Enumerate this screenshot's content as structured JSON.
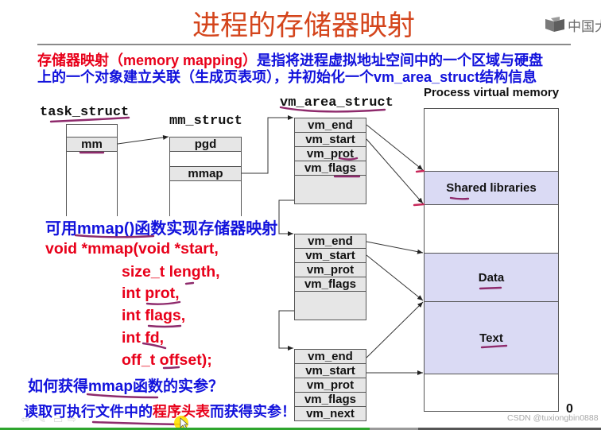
{
  "slide": {
    "title": "进程的存储器映射",
    "logo": {
      "icon": "book-logo-icon",
      "text": "中国大"
    },
    "intro": {
      "line1_red": "存储器映射（memory mapping）",
      "line1_blue": "是指将进程虚拟地址空间中的一个区域与硬盘",
      "line2": "上的一个对象建立关联（生成页表项），并初始化一个vm_area_struct结构信息"
    },
    "diagram": {
      "task_struct": {
        "label": "task_struct",
        "fields": [
          "mm"
        ]
      },
      "mm_struct": {
        "label": "mm_struct",
        "fields": [
          "pgd",
          "mmap"
        ]
      },
      "vm_area_struct": {
        "label": "vm_area_struct",
        "nodes": [
          {
            "fields": [
              "vm_end",
              "vm_start",
              "vm_prot",
              "vm_flags"
            ]
          },
          {
            "fields": [
              "vm_end",
              "vm_start",
              "vm_prot",
              "vm_flags"
            ]
          },
          {
            "fields": [
              "vm_end",
              "vm_start",
              "vm_prot",
              "vm_flags",
              "vm_next"
            ]
          }
        ]
      },
      "process_memory": {
        "label": "Process virtual memory",
        "regions": [
          "Shared libraries",
          "Data",
          "Text"
        ],
        "bottom_address": "0"
      }
    },
    "mmap_section": {
      "heading": "可用mmap()函数实现存储器映射",
      "signature": [
        "void *mmap(void *start,",
        "size_t length,",
        "int prot,",
        "int flags,",
        "int fd,",
        "off_t offset);"
      ],
      "question": "如何获得mmap函数的实参？",
      "answer": {
        "before": "读取可执行文件中的",
        "highlight": "程序头表",
        "after": "而获得实参！"
      }
    }
  },
  "watermark": "CSDN @tuxiongbin0888",
  "player": {
    "nav_icons": [
      "previous-arrow-icon",
      "pen-icon",
      "menu-icon",
      "next-arrow-icon"
    ],
    "played_fraction": 0.615,
    "buffered_fraction": 0.696
  },
  "colors": {
    "title": "#d4451c",
    "red_text": "#e8001a",
    "blue_text": "#1212dc",
    "annotation": "#8e2a6c",
    "region_fill": "#dadaf4",
    "field_fill": "#e6e6e6",
    "progress_played": "#2ea52e",
    "progress_buffered": "#9a9a9a",
    "progress_track": "#555555"
  }
}
